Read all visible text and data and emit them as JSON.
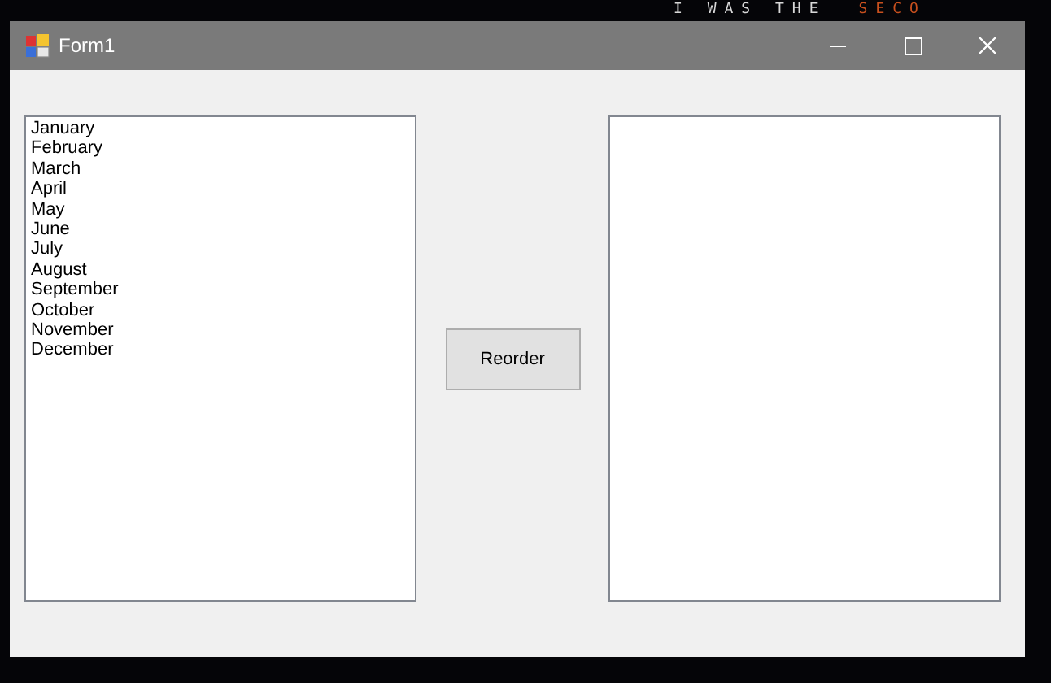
{
  "background": {
    "top_line": [
      {
        "text": "I WAS THE",
        "kind": "plain"
      },
      {
        "text": "SECO",
        "kind": "accent"
      }
    ]
  },
  "window": {
    "title": "Form1"
  },
  "source_list": {
    "items": [
      "January",
      "February",
      "March",
      "April",
      "May",
      "June",
      "July",
      "August",
      "September",
      "October",
      "November",
      "December"
    ]
  },
  "button": "Reorder"
}
